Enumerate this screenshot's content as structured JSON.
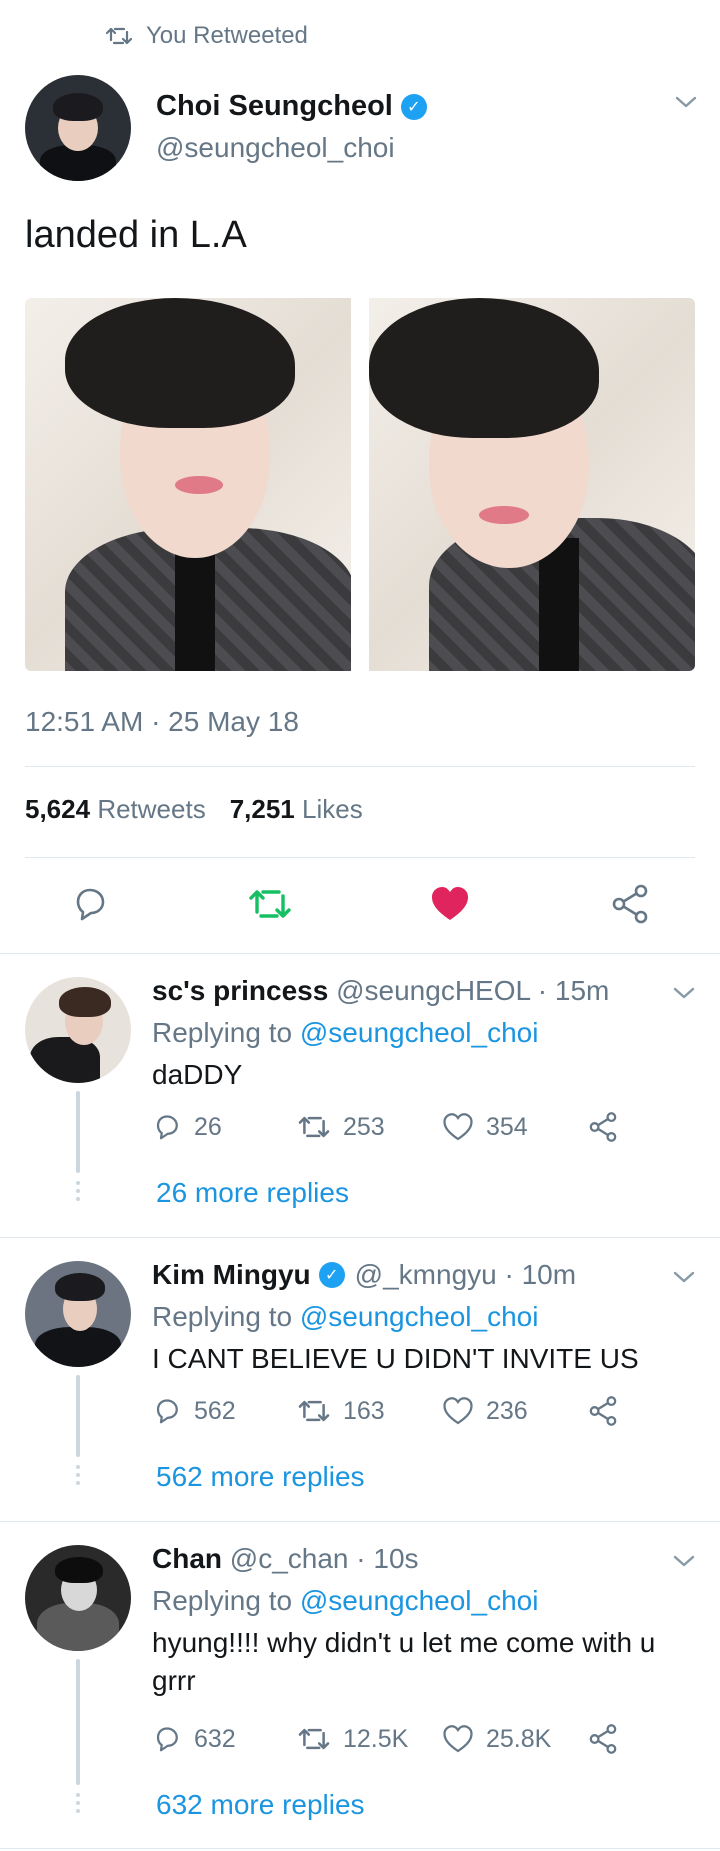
{
  "retweet_banner": "You Retweeted",
  "tweet": {
    "author_name": "Choi Seungcheol",
    "author_handle": "@seungcheol_choi",
    "text": "landed in L.A",
    "timestamp": "12:51 AM · 25 May 18",
    "retweets_count": "5,624",
    "retweets_label": "Retweets",
    "likes_count": "7,251",
    "likes_label": "Likes",
    "retweeted": true,
    "liked": true
  },
  "colors": {
    "accent": "#1da1f2",
    "link": "#1b95e0",
    "retweet_green": "#17bf63",
    "like_red": "#e0245e",
    "muted": "#657786"
  },
  "icons": {
    "banner": "retweet-icon",
    "verified": "verified-badge-icon",
    "menu": "chevron-down-icon",
    "actions": [
      "reply-icon",
      "retweet-icon",
      "like-icon",
      "share-icon"
    ]
  },
  "replies": [
    {
      "name": "sc's princess",
      "verified": false,
      "handle_time": "@seungcHEOL · 15m",
      "replying_label": "Replying to",
      "replying_to": "@seungcheol_choi",
      "text": "daDDY",
      "reply_count": "26",
      "retweet_count": "253",
      "like_count": "354",
      "more_replies": "26 more replies"
    },
    {
      "name": "Kim Mingyu",
      "verified": true,
      "handle_time": "@_kmngyu · 10m",
      "replying_label": "Replying to",
      "replying_to": "@seungcheol_choi",
      "text": "I CANT BELIEVE U DIDN'T INVITE US",
      "reply_count": "562",
      "retweet_count": "163",
      "like_count": "236",
      "more_replies": "562 more replies"
    },
    {
      "name": "Chan",
      "verified": false,
      "handle_time": "@c_chan · 10s",
      "replying_label": "Replying to",
      "replying_to": "@seungcheol_choi",
      "text": "hyung!!!! why didn't u let me come with u grrr",
      "reply_count": "632",
      "retweet_count": "12.5K",
      "like_count": "25.8K",
      "more_replies": "632 more replies"
    }
  ]
}
